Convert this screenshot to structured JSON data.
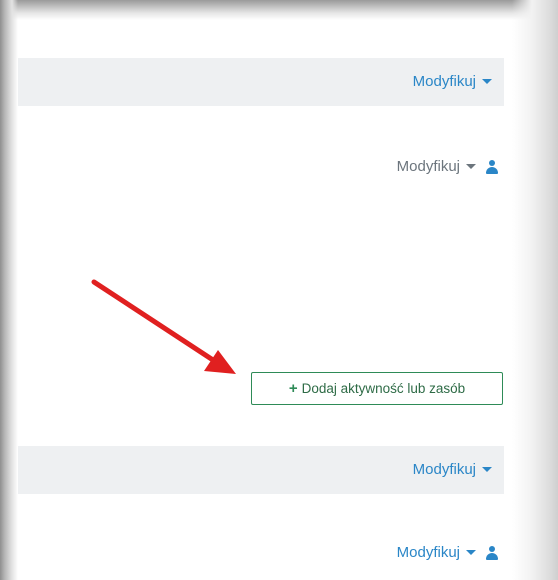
{
  "sections": [
    {
      "header_modify_label": "Modyfikuj",
      "row_modify_label": "Modyfikuj"
    },
    {
      "header_modify_label": "Modyfikuj",
      "row_modify_label": "Modyfikuj"
    }
  ],
  "add_button": {
    "label": "Dodaj aktywność lub zasób",
    "icon": "plus-icon"
  },
  "icons": {
    "caret": "caret-down-icon",
    "user": "user-icon",
    "arrow": "red-arrow"
  },
  "colors": {
    "accent": "#2a86c7",
    "button_border": "#2e8b57",
    "arrow": "#e02020",
    "section_bg": "#eef0f2"
  }
}
